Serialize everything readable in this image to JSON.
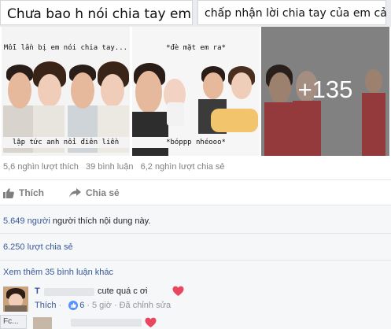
{
  "top_cards": [
    {
      "text": "Chưa bao h nói chia tay em"
    },
    {
      "text": "chấp nhận lời chia tay của em cả"
    }
  ],
  "photos": [
    {
      "caption_top": "Mỗi lần bị em nói chia tay...",
      "caption_bottom": "lập tức anh nổi điên liền"
    },
    {
      "caption_top": "*đè mặt em ra*",
      "caption_bottom": "*bóppp nhéooo*"
    },
    {
      "more_count": "+135"
    }
  ],
  "stats": {
    "likes": "5,6 nghìn lượt thích",
    "comments": "39 bình luận",
    "shares": "6,2 nghìn lượt chia sẻ"
  },
  "actions": {
    "like_label": "Thích",
    "share_label": "Chia sẻ"
  },
  "details": {
    "people_like_count": "5.649 người",
    "people_like_suffix": " người thích nội dung này.",
    "shares_line": "6.250 lượt chia sẻ",
    "more_comments": "Xem thêm 35 bình luận khác"
  },
  "comments": [
    {
      "name": "T",
      "text": "cute quá c ơi",
      "like_label": "Thích",
      "like_count": "6",
      "time": "5 giờ",
      "edited": "Đã chỉnh sửa"
    },
    {
      "name": "",
      "text": ""
    }
  ],
  "edge_tab": {
    "label": "Fc..."
  },
  "colors": {
    "link": "#365899",
    "muted": "#7f7f7f",
    "heart": "#e8475f",
    "like_blue": "#5890ff"
  }
}
